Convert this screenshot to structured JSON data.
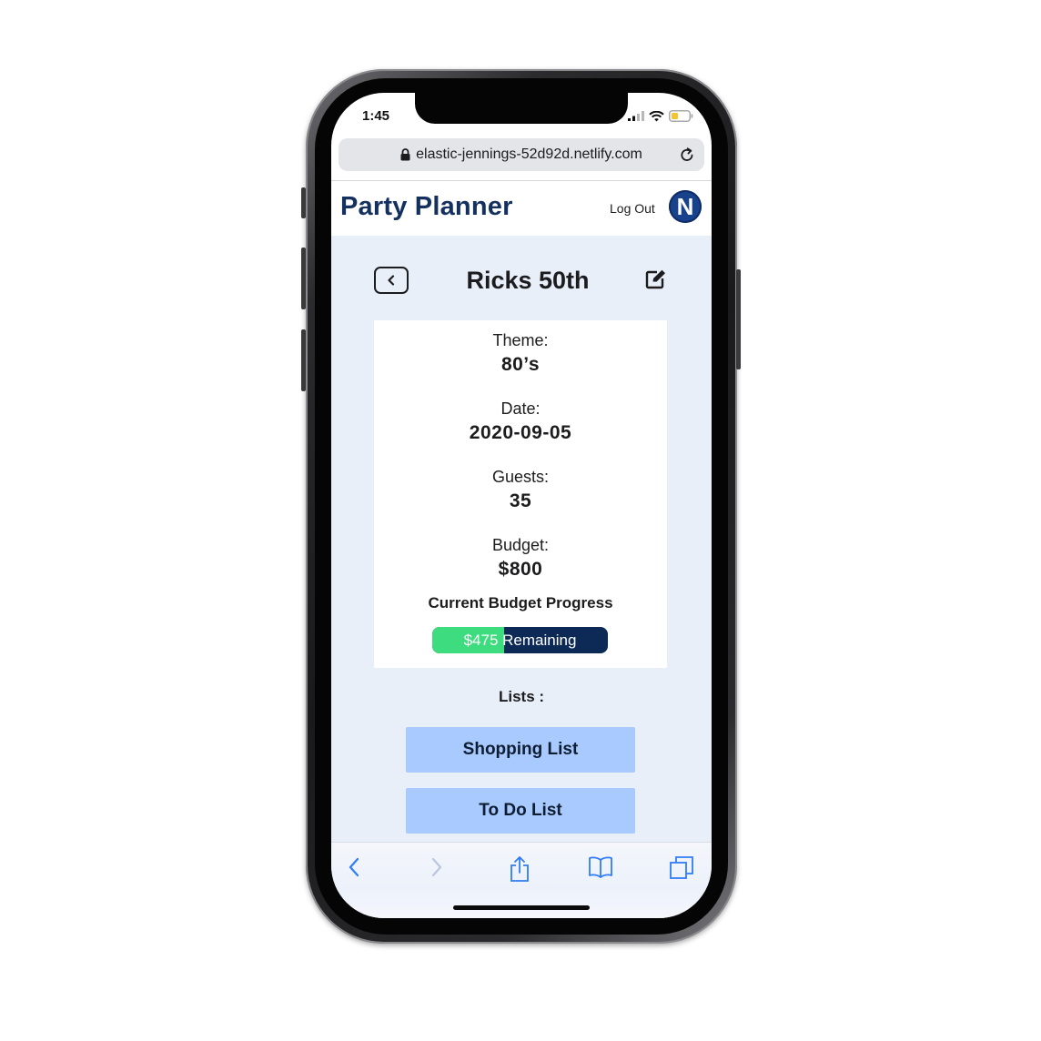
{
  "status_bar": {
    "time": "1:45"
  },
  "browser": {
    "url": "elastic-jennings-52d92d.netlify.com"
  },
  "header": {
    "title": "Party Planner",
    "logout_label": "Log Out",
    "avatar_initial": "N"
  },
  "event": {
    "title": "Ricks 50th",
    "details": [
      {
        "label": "Theme:",
        "value": "80’s"
      },
      {
        "label": "Date:",
        "value": "2020-09-05"
      },
      {
        "label": "Guests:",
        "value": "35"
      },
      {
        "label": "Budget:",
        "value": "$800"
      }
    ],
    "progress_heading": "Current Budget Progress",
    "progress_text": "$475 Remaining",
    "progress_fraction": 0.41
  },
  "lists": {
    "label": "Lists :",
    "buttons": [
      "Shopping List",
      "To Do List"
    ]
  },
  "colors": {
    "brand": "#14305f",
    "avatar": "#19428c",
    "page_bg": "#e9eff9",
    "list_button": "#a9caff",
    "progress_fill": "#3ddc7e",
    "progress_track": "#0d2a57",
    "safari_blue": "#2f7cf6"
  },
  "toolbar_icons": [
    "back-icon",
    "forward-icon",
    "share-icon",
    "bookmarks-icon",
    "tabs-icon"
  ]
}
